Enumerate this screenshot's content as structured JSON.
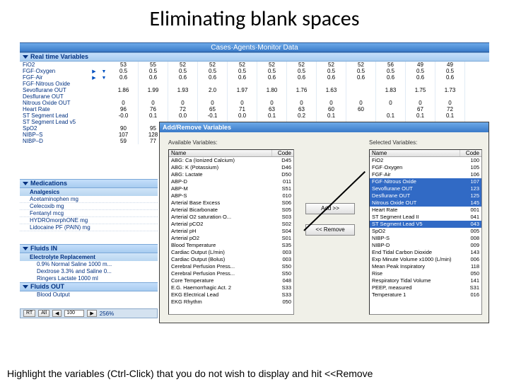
{
  "slide": {
    "title": "Eliminating blank spaces",
    "caption": "Highlight the variables (Ctrl-Click) that you do not wish to display and hit <<Remove"
  },
  "ribbon": "Cases·Agents·Monitor Data",
  "rt": {
    "header": "Real time Variables",
    "rows": [
      {
        "name": "FiO2",
        "up": false,
        "vals": [
          "53",
          "55",
          "52",
          "52",
          "52",
          "52",
          "52",
          "52",
          "52",
          "56",
          "49",
          "49"
        ]
      },
      {
        "name": "FGF·Oxygen",
        "up": true,
        "dn": true,
        "vals": [
          "0.5",
          "0.5",
          "0.5",
          "0.5",
          "0.5",
          "0.5",
          "0.5",
          "0.5",
          "0.5",
          "0.5",
          "0.5",
          "0.5"
        ]
      },
      {
        "name": "FGF·Air",
        "up": true,
        "dn": true,
        "vals": [
          "0.6",
          "0.6",
          "0.6",
          "0.6",
          "0.6",
          "0.6",
          "0.6",
          "0.6",
          "0.6",
          "0.6",
          "0.6",
          "0.6"
        ]
      },
      {
        "name": "FGF·Nitrous Oxide",
        "vals": [
          "",
          "",
          "",
          "",
          "",
          "",
          "",
          "",
          "",
          "",
          "",
          ""
        ]
      },
      {
        "name": "Sevoflurane OUT",
        "vals": [
          "1.86",
          "1.99",
          "1.93",
          "2.0",
          "1.97",
          "1.80",
          "1.76",
          "1.63",
          "",
          "1.83",
          "1.75",
          "1.73"
        ]
      },
      {
        "name": "Desflurane OUT",
        "vals": [
          "",
          "",
          "",
          "",
          "",
          "",
          "",
          "",
          "",
          "",
          "",
          ""
        ]
      },
      {
        "name": "Nitrous Oxide OUT",
        "vals": [
          "0",
          "0",
          "0",
          "0",
          "0",
          "0",
          "0",
          "0",
          "0",
          "0",
          "0",
          "0"
        ]
      },
      {
        "name": "Heart Rate",
        "vals": [
          "96",
          "76",
          "72",
          "65",
          "71",
          "63",
          "63",
          "60",
          "60",
          "",
          "67",
          "72"
        ]
      },
      {
        "name": "ST Segment Lead",
        "vals": [
          "-0.0",
          "0.1",
          "0.0",
          "-0.1",
          "0.0",
          "0.1",
          "0.2",
          "0.1",
          "",
          "0.1",
          "0.1",
          "0.1"
        ]
      },
      {
        "name": "ST Segment Lead v5",
        "vals": [
          "",
          "",
          "",
          "",
          "",
          "",
          "",
          "",
          "",
          "",
          "",
          ""
        ]
      },
      {
        "name": "SpO2",
        "vals": [
          "90",
          "95"
        ]
      },
      {
        "name": "NIBP–S",
        "vals": [
          "107",
          "128"
        ]
      },
      {
        "name": "NIBP–D",
        "vals": [
          "59",
          "77"
        ]
      }
    ]
  },
  "meds": {
    "header": "Medications",
    "sub": "Analgesics",
    "items": [
      "Acetaminophen mg",
      "Celecoxib mg",
      "Fentanyl mcg",
      "HYDROmorphONE mg",
      "Lidocaine PF (PAIN) mg"
    ]
  },
  "fluidsIn": {
    "header": "Fluids IN",
    "sub": "Electrolyte Replacement",
    "items": [
      "0.9% Normal Saline 1000 m...",
      "Dextrose 3.3% and Saline 0...",
      "Ringers Lactate 1000 ml"
    ]
  },
  "fluidsOut": {
    "header": "Fluids OUT",
    "items": [
      "Blood Output"
    ]
  },
  "bottombar": {
    "rt": "RT",
    "all": "All",
    "zoom": "100",
    "pct": "256%"
  },
  "dialog": {
    "title": "Add/Remove Variables",
    "availLabel": "Available Variables:",
    "selLabel": "Selected Variables:",
    "nameHdr": "Name",
    "codeHdr": "Code",
    "addBtn": "Add >>",
    "removeBtn": "<< Remove",
    "available": [
      {
        "n": "ABG: Ca (Ionized Calcium)",
        "c": "D45"
      },
      {
        "n": "ABG: K (Potassium)",
        "c": "D46"
      },
      {
        "n": "ABG: Lactate",
        "c": "D50"
      },
      {
        "n": "ABP-D",
        "c": "011"
      },
      {
        "n": "ABP-M",
        "c": "S51"
      },
      {
        "n": "ABP-S",
        "c": "010"
      },
      {
        "n": "Arterial Base Excess",
        "c": "S06"
      },
      {
        "n": "Arterial Bicarbonate",
        "c": "S05"
      },
      {
        "n": "Arterial O2 saturation O...",
        "c": "S03"
      },
      {
        "n": "Arterial pCO2",
        "c": "S02"
      },
      {
        "n": "Arterial pH",
        "c": "S04"
      },
      {
        "n": "Arterial pO2",
        "c": "S01"
      },
      {
        "n": "Blood Temperature",
        "c": "S35"
      },
      {
        "n": "Cardiac Output (L/min)",
        "c": "003"
      },
      {
        "n": "Cardiac Output (Bolus)",
        "c": "003"
      },
      {
        "n": "Cerebral Perfusion Press...",
        "c": "S50"
      },
      {
        "n": "Cerebral Perfusion Press...",
        "c": "S50"
      },
      {
        "n": "Core Temperature",
        "c": "048"
      },
      {
        "n": "E.G. Haemorrhagic Act. 2",
        "c": "S33"
      },
      {
        "n": "EKG Electrical Lead",
        "c": "S33"
      },
      {
        "n": "EKG Rhythm",
        "c": "050"
      }
    ],
    "selected": [
      {
        "n": "FiO2",
        "c": "100",
        "sel": false
      },
      {
        "n": "FGF·Oxygen",
        "c": "105",
        "sel": false
      },
      {
        "n": "FGF·Air",
        "c": "106",
        "sel": false
      },
      {
        "n": "FGF·Nitrous Oxide",
        "c": "107",
        "sel": true
      },
      {
        "n": "Sevoflurane OUT",
        "c": "123",
        "sel": true
      },
      {
        "n": "Desflurane OUT",
        "c": "125",
        "sel": true
      },
      {
        "n": "Nitrous Oxide OUT",
        "c": "145",
        "sel": true
      },
      {
        "n": "Heart Rate",
        "c": "001",
        "sel": false
      },
      {
        "n": "ST Segment Lead II",
        "c": "041",
        "sel": false
      },
      {
        "n": "ST Segment Lead V5",
        "c": "043",
        "sel": true
      },
      {
        "n": "SpO2",
        "c": "005",
        "sel": false
      },
      {
        "n": "NIBP-S",
        "c": "008",
        "sel": false
      },
      {
        "n": "NIBP-D",
        "c": "009",
        "sel": false
      },
      {
        "n": "End Tidal Carbon Dioxide",
        "c": "143",
        "sel": false
      },
      {
        "n": "Exp Minute Volume x1000 (L/min)",
        "c": "006",
        "sel": false
      },
      {
        "n": "Mean Peak Inspiratory",
        "c": "118",
        "sel": false
      },
      {
        "n": "Rise",
        "c": "050",
        "sel": false
      },
      {
        "n": "Respiratory Tidal Volume",
        "c": "141",
        "sel": false
      },
      {
        "n": "PEEP, measured",
        "c": "S31",
        "sel": false
      },
      {
        "n": "Temperature 1",
        "c": "016",
        "sel": false
      }
    ]
  }
}
